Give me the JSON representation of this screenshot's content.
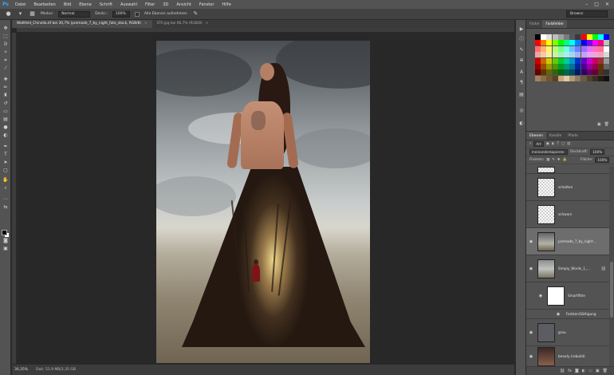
{
  "menu": {
    "app_icon": "Ps",
    "items": [
      "Datei",
      "Bearbeiten",
      "Bild",
      "Ebene",
      "Schrift",
      "Auswahl",
      "Filter",
      "3D",
      "Ansicht",
      "Fenster",
      "Hilfe"
    ],
    "window_controls": [
      "minimize-icon",
      "maximize-icon",
      "close-icon"
    ]
  },
  "options": {
    "mode_label": "Modus:",
    "mode_value": "Normal",
    "opacity_label": "Deckr.:",
    "opacity_value": "100%",
    "sample_all_label": "Alle Ebenen aufnehmen",
    "workspace_value": "Browns"
  },
  "tabs": [
    {
      "label": "Wattfeld_Chinella.tif bei 30,7% (premade_7_by_night_fate_stock, RGB/8)",
      "active": true
    },
    {
      "label": "STA.jpg bei 66,7% (RGB/8)",
      "active": false
    }
  ],
  "status": {
    "zoom": "30,35%",
    "doc_info": "Dok: 51,9 MB/2,35 GB"
  },
  "panels": {
    "color_tabs": [
      "Farbe",
      "Farbfelder"
    ],
    "active_color_tab": "Farbfelder",
    "layer_tabs": [
      "Ebenen",
      "Kanäle",
      "Pfade"
    ],
    "active_layer_tab": "Ebenen",
    "filter_label": "Art",
    "blend_mode": "Ineinanderkopieren",
    "opacity_label": "Deckkraft:",
    "opacity_value": "100%",
    "lock_label": "Fixieren:",
    "fill_label": "Fläche:",
    "fill_value": "100%"
  },
  "layers": [
    {
      "name": "",
      "selected": false,
      "visible": false
    },
    {
      "name": "schatten",
      "selected": false,
      "visible": false
    },
    {
      "name": "schwarz",
      "selected": false,
      "visible": false
    },
    {
      "name": "premade_7_by_night...",
      "selected": true,
      "visible": true
    },
    {
      "name": "Simply_Words_1_...",
      "selected": false,
      "visible": true
    },
    {
      "name": "Smartfilter",
      "selected": false,
      "visible": true
    },
    {
      "name": "Farbton/Sättigung",
      "selected": false,
      "visible": true
    },
    {
      "name": "grau",
      "selected": false,
      "visible": true
    },
    {
      "name": "beauty (rebuild)",
      "selected": false,
      "visible": true
    }
  ],
  "swatch_colors": [
    "#000000",
    "#ffffff",
    "#e0e0e0",
    "#bdbdbd",
    "#9e9e9e",
    "#7b7b7b",
    "#575757",
    "#3a3a3a",
    "#ff0000",
    "#ffff00",
    "#00ff00",
    "#00ffff",
    "#0000ff",
    "#ff0000",
    "#ff7f00",
    "#ffff00",
    "#7fff00",
    "#00ff00",
    "#00ff7f",
    "#00ffff",
    "#007fff",
    "#0000ff",
    "#7f00ff",
    "#ff00ff",
    "#ff007f",
    "#c0c0c0",
    "#ff6f6f",
    "#ffb36f",
    "#fff46f",
    "#b3ff6f",
    "#6fff8a",
    "#6fffe6",
    "#6fbfff",
    "#6f7fff",
    "#9b6fff",
    "#e46fff",
    "#ff6fc8",
    "#ff6f9b",
    "#ffffff",
    "#f1a2a2",
    "#f5c9a2",
    "#f7eda2",
    "#c9f1a2",
    "#a2f1b5",
    "#a2f1e6",
    "#a2d6f5",
    "#a2b1f5",
    "#c2a2f5",
    "#e9a2f5",
    "#f5a2d8",
    "#f5a2b7",
    "#d8d8d8",
    "#cc0000",
    "#cc6600",
    "#cccc00",
    "#66cc00",
    "#00cc33",
    "#00cc99",
    "#0099cc",
    "#0033cc",
    "#6600cc",
    "#cc00cc",
    "#cc0066",
    "#993333",
    "#999999",
    "#990000",
    "#994c00",
    "#999900",
    "#4c9900",
    "#009926",
    "#009973",
    "#007399",
    "#002699",
    "#4c0099",
    "#990099",
    "#99004c",
    "#663300",
    "#666666",
    "#660000",
    "#663300",
    "#666600",
    "#336600",
    "#006619",
    "#00664c",
    "#004c66",
    "#001966",
    "#330066",
    "#660066",
    "#660033",
    "#4d3319",
    "#333333",
    "#a5835a",
    "#8c6b44",
    "#72552f",
    "#5c4220",
    "#c9a77c",
    "#e0c9a6",
    "#b39b7a",
    "#8e7a5f",
    "#6b5a44",
    "#4f402e",
    "#3a2e20",
    "#261e15",
    "#111111"
  ]
}
